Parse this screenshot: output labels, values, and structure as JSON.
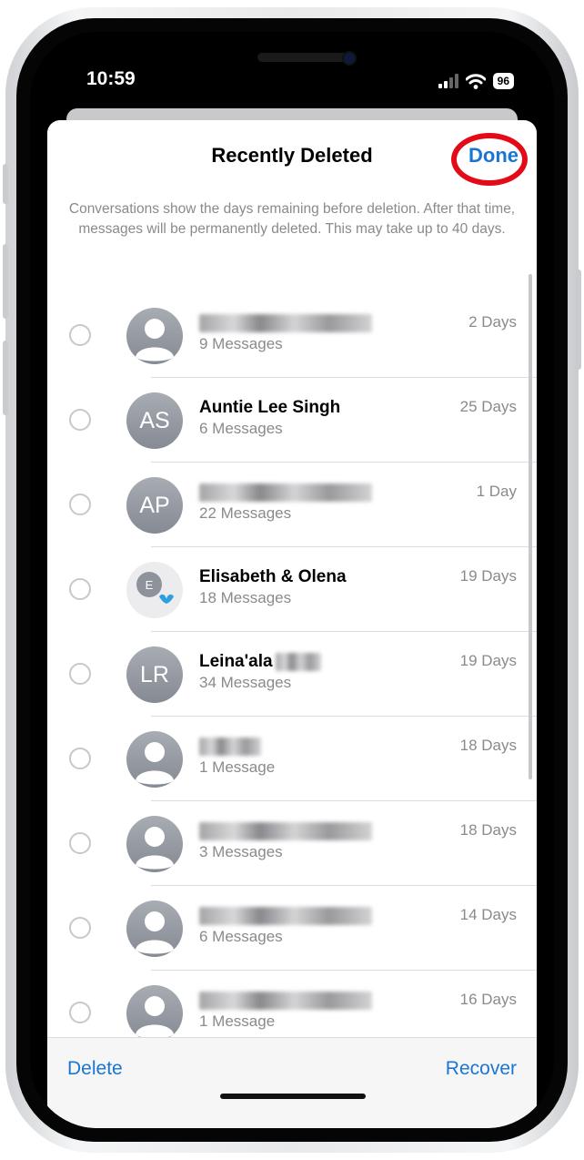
{
  "status_bar": {
    "time": "10:59",
    "battery": "96"
  },
  "header": {
    "title": "Recently Deleted",
    "done_label": "Done"
  },
  "description": "Conversations show the days remaining before deletion. After that time, messages will be permanently deleted. This may take up to 40 days.",
  "conversations": [
    {
      "name": "",
      "blurred_width": 190,
      "initials": "",
      "count": "9 Messages",
      "days": "2 Days"
    },
    {
      "name": "Auntie Lee Singh",
      "blurred_width": 0,
      "initials": "AS",
      "count": "6 Messages",
      "days": "25 Days"
    },
    {
      "name": "",
      "blurred_width": 190,
      "initials": "AP",
      "count": "22 Messages",
      "days": "1 Day"
    },
    {
      "name": "Elisabeth & Olena",
      "blurred_width": 0,
      "initials": "E",
      "count": "18 Messages",
      "days": "19 Days"
    },
    {
      "name": "Leina'ala",
      "blurred_width": 50,
      "initials": "LR",
      "count": "34 Messages",
      "days": "19 Days"
    },
    {
      "name": "",
      "blurred_width": 68,
      "initials": "",
      "count": "1 Message",
      "days": "18 Days"
    },
    {
      "name": "",
      "blurred_width": 190,
      "initials": "",
      "count": "3 Messages",
      "days": "18 Days"
    },
    {
      "name": "",
      "blurred_width": 190,
      "initials": "",
      "count": "6 Messages",
      "days": "14 Days"
    },
    {
      "name": "",
      "blurred_width": 190,
      "initials": "",
      "count": "1 Message",
      "days": "16 Days"
    }
  ],
  "toolbar": {
    "delete_label": "Delete",
    "recover_label": "Recover"
  },
  "colors": {
    "accent": "#1b76d1",
    "highlight_ring": "#e30b17",
    "secondary_text": "#8a8a8e"
  }
}
